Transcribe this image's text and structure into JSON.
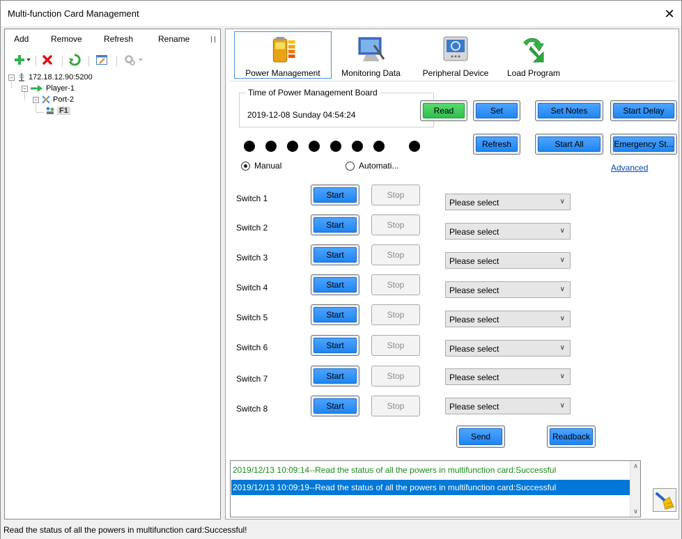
{
  "window": {
    "title": "Multi-function Card Management",
    "close_glyph": "✕"
  },
  "left": {
    "menu": {
      "add": "Add",
      "remove": "Remove",
      "refresh": "Refresh",
      "rename": "Rename"
    },
    "tree": {
      "server": "172.18.12.90:5200",
      "player": "Player-1",
      "port": "Port-2",
      "card": "F1"
    }
  },
  "tabs": [
    {
      "label": "Power Management",
      "icon": "battery-icon",
      "active": true
    },
    {
      "label": "Monitoring Data",
      "icon": "monitor-icon",
      "active": false
    },
    {
      "label": "Peripheral Device",
      "icon": "device-icon",
      "active": false
    },
    {
      "label": "Load Program",
      "icon": "download-arrow-icon",
      "active": false
    }
  ],
  "power_board": {
    "group_title": "Time of Power Management Board",
    "time": "2019-12-08 Sunday 04:54:24",
    "read": "Read",
    "set": "Set",
    "set_notes": "Set Notes",
    "start_delay": "Start Delay",
    "refresh": "Refresh",
    "start_all": "Start All",
    "emergency": "Emergency St...",
    "manual": "Manual",
    "automatic": "Automati...",
    "advanced": "Advanced",
    "indicator_count": 8
  },
  "switches": [
    {
      "label": "Switch 1",
      "start": "Start",
      "stop": "Stop",
      "select": "Please select"
    },
    {
      "label": "Switch 2",
      "start": "Start",
      "stop": "Stop",
      "select": "Please select"
    },
    {
      "label": "Switch 3",
      "start": "Start",
      "stop": "Stop",
      "select": "Please select"
    },
    {
      "label": "Switch 4",
      "start": "Start",
      "stop": "Stop",
      "select": "Please select"
    },
    {
      "label": "Switch 5",
      "start": "Start",
      "stop": "Stop",
      "select": "Please select"
    },
    {
      "label": "Switch 6",
      "start": "Start",
      "stop": "Stop",
      "select": "Please select"
    },
    {
      "label": "Switch 7",
      "start": "Start",
      "stop": "Stop",
      "select": "Please select"
    },
    {
      "label": "Switch 8",
      "start": "Start",
      "stop": "Stop",
      "select": "Please select"
    }
  ],
  "actions": {
    "send": "Send",
    "readback": "Readback"
  },
  "log": [
    "2019/12/13 10:09:14--Read the status of all the powers in multifunction card:Successful",
    "2019/12/13 10:09:19--Read the status of all the powers in multifunction card:Successful"
  ],
  "status": "Read the status of all the powers in multifunction card:Successful!",
  "colors": {
    "accent_blue": "#1f86f0",
    "ok_green": "#1a8a1a",
    "selection": "#0078d7",
    "read_green": "#2fbf4c"
  }
}
